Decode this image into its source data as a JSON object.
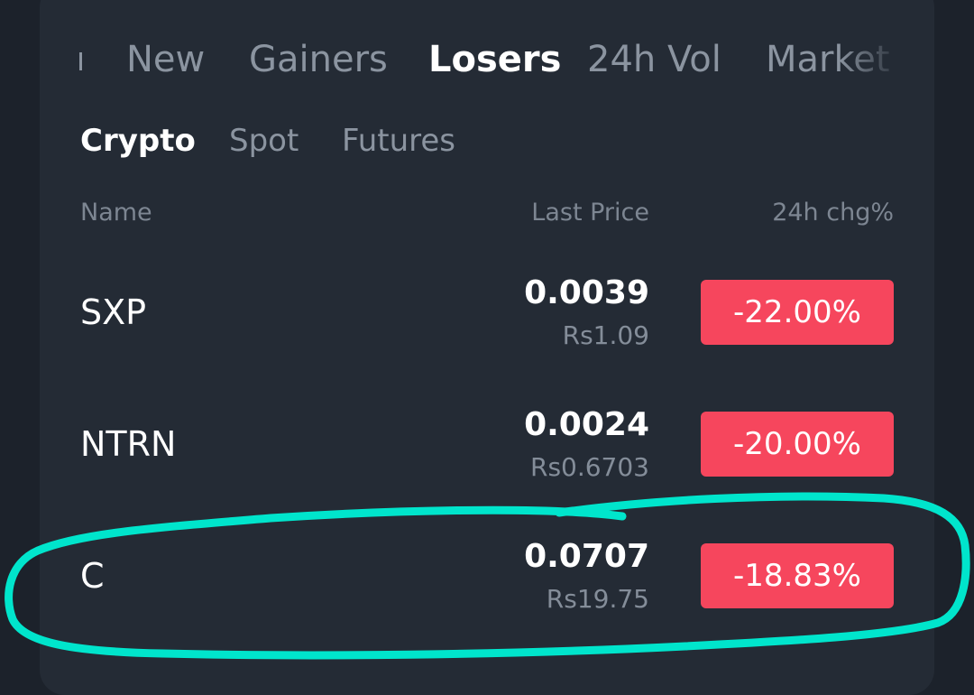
{
  "tabs": [
    {
      "label": "New"
    },
    {
      "label": "Gainers"
    },
    {
      "label": "Losers",
      "active": true
    },
    {
      "label": "24h Vol"
    },
    {
      "label": "Market"
    }
  ],
  "subtabs": [
    {
      "label": "Crypto",
      "active": true
    },
    {
      "label": "Spot"
    },
    {
      "label": "Futures"
    }
  ],
  "columns": {
    "name": "Name",
    "last_price": "Last Price",
    "change": "24h chg%"
  },
  "rows": [
    {
      "symbol": "SXP",
      "price": "0.0039",
      "fiat": "Rs1.09",
      "change": "-22.00%"
    },
    {
      "symbol": "NTRN",
      "price": "0.0024",
      "fiat": "Rs0.6703",
      "change": "-20.00%"
    },
    {
      "symbol": "C",
      "price": "0.0707",
      "fiat": "Rs19.75",
      "change": "-18.83%"
    }
  ],
  "colors": {
    "background": "#1c222b",
    "panel": "#242b35",
    "loss_red": "#f6465d",
    "annotation_cyan": "#00e5cc"
  }
}
